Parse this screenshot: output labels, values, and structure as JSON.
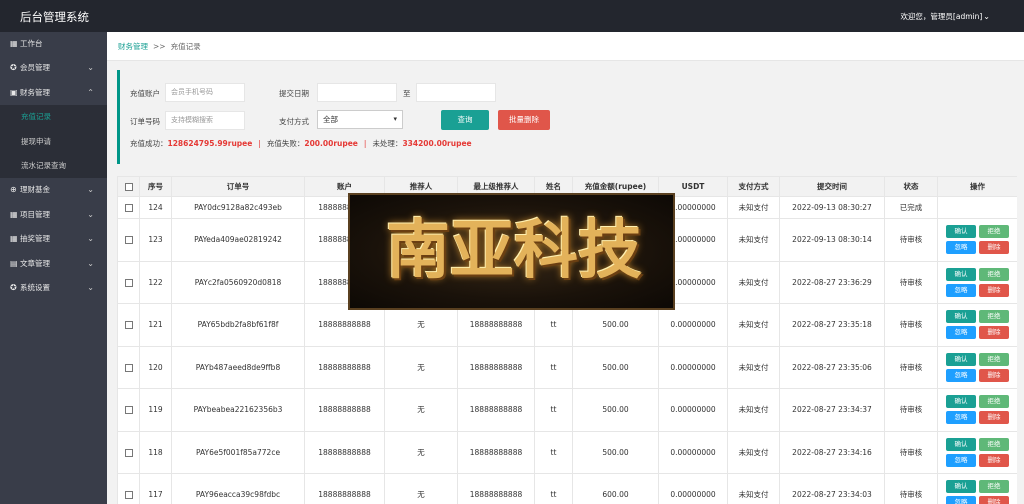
{
  "app": {
    "title": "后台管理系统",
    "user_menu": "欢迎您，管理员[admin]"
  },
  "sidebar": {
    "items": [
      {
        "label": "工作台",
        "icon": "dashboard-icon",
        "has_arrow": false
      },
      {
        "label": "会员管理",
        "icon": "settings-icon",
        "has_arrow": true
      },
      {
        "label": "财务管理",
        "icon": "finance-icon",
        "has_arrow": true,
        "expanded": true
      },
      {
        "label": "理财基金",
        "icon": "plus-circle-icon",
        "has_arrow": true
      },
      {
        "label": "项目管理",
        "icon": "project-icon",
        "has_arrow": true
      },
      {
        "label": "抽奖管理",
        "icon": "lottery-icon",
        "has_arrow": true
      },
      {
        "label": "文章管理",
        "icon": "article-icon",
        "has_arrow": true
      },
      {
        "label": "系统设置",
        "icon": "gear-icon",
        "has_arrow": true
      }
    ],
    "finance_sub": [
      "充值记录",
      "提现申请",
      "流水记录查询"
    ],
    "active_sub": "充值记录"
  },
  "breadcrumb": {
    "parent": "财务管理",
    "separator": ">>",
    "current": "充值记录"
  },
  "filter": {
    "account_label": "充值账户",
    "account_placeholder": "会员手机号码",
    "date_label": "提交日期",
    "date_to": "至",
    "order_label": "订单号码",
    "order_placeholder": "支持模糊搜索",
    "pay_method_label": "支付方式",
    "pay_method_value": "全部",
    "search_button": "查询",
    "batch_delete_button": "批量删除"
  },
  "stats": {
    "success_label": "充值成功：",
    "success_value": "128624795.99rupee",
    "failed_label": "充值失败：",
    "failed_value": "200.00rupee",
    "pending_label": "未处理：",
    "pending_value": "334200.00rupee"
  },
  "table": {
    "headers": [
      "",
      "序号",
      "订单号",
      "账户",
      "推荐人",
      "最上级推荐人",
      "姓名",
      "充值金额(rupee)",
      "USDT",
      "支付方式",
      "提交时间",
      "状态",
      "操作"
    ],
    "op_labels": {
      "confirm": "确认",
      "reject": "拒绝",
      "ignore": "忽略",
      "delete": "删除"
    },
    "rows": [
      {
        "id": "124",
        "order": "PAY0dc9128a82c493eb",
        "account": "18888888888",
        "referrer": "无",
        "top_referrer": "18888888888",
        "name": "tt",
        "amount": "500.00",
        "usdt": "0.00000000",
        "method": "未知支付",
        "time": "2022-09-13 08:30:27",
        "status": "已完成"
      },
      {
        "id": "123",
        "order": "PAYeda409ae02819242",
        "account": "18888888888",
        "referrer": "无",
        "top_referrer": "18888888888",
        "name": "tt",
        "amount": "500.00",
        "usdt": "0.00000000",
        "method": "未知支付",
        "time": "2022-09-13 08:30:14",
        "status": "待审核"
      },
      {
        "id": "122",
        "order": "PAYc2fa0560920d0818",
        "account": "18888888888",
        "referrer": "无",
        "top_referrer": "18888888888",
        "name": "tt",
        "amount": "500.00",
        "usdt": "0.00000000",
        "method": "未知支付",
        "time": "2022-08-27 23:36:29",
        "status": "待审核"
      },
      {
        "id": "121",
        "order": "PAY65bdb2fa8bf61f8f",
        "account": "18888888888",
        "referrer": "无",
        "top_referrer": "18888888888",
        "name": "tt",
        "amount": "500.00",
        "usdt": "0.00000000",
        "method": "未知支付",
        "time": "2022-08-27 23:35:18",
        "status": "待审核"
      },
      {
        "id": "120",
        "order": "PAYb487aeed8de9ffb8",
        "account": "18888888888",
        "referrer": "无",
        "top_referrer": "18888888888",
        "name": "tt",
        "amount": "500.00",
        "usdt": "0.00000000",
        "method": "未知支付",
        "time": "2022-08-27 23:35:06",
        "status": "待审核"
      },
      {
        "id": "119",
        "order": "PAYbeabea22162356b3",
        "account": "18888888888",
        "referrer": "无",
        "top_referrer": "18888888888",
        "name": "tt",
        "amount": "500.00",
        "usdt": "0.00000000",
        "method": "未知支付",
        "time": "2022-08-27 23:34:37",
        "status": "待审核"
      },
      {
        "id": "118",
        "order": "PAY6e5f001f85a772ce",
        "account": "18888888888",
        "referrer": "无",
        "top_referrer": "18888888888",
        "name": "tt",
        "amount": "500.00",
        "usdt": "0.00000000",
        "method": "未知支付",
        "time": "2022-08-27 23:34:16",
        "status": "待审核"
      },
      {
        "id": "117",
        "order": "PAY96eacca39c98fdbc",
        "account": "18888888888",
        "referrer": "无",
        "top_referrer": "18888888888",
        "name": "tt",
        "amount": "600.00",
        "usdt": "0.00000000",
        "method": "未知支付",
        "time": "2022-08-27 23:34:03",
        "status": "待审核"
      }
    ]
  },
  "watermark": {
    "text": "南亚科技"
  },
  "colors": {
    "topbar": "#23262e",
    "sidebar": "#393d49",
    "accent": "#1aa094",
    "danger": "#e0564a",
    "highlight": "#e53935"
  }
}
